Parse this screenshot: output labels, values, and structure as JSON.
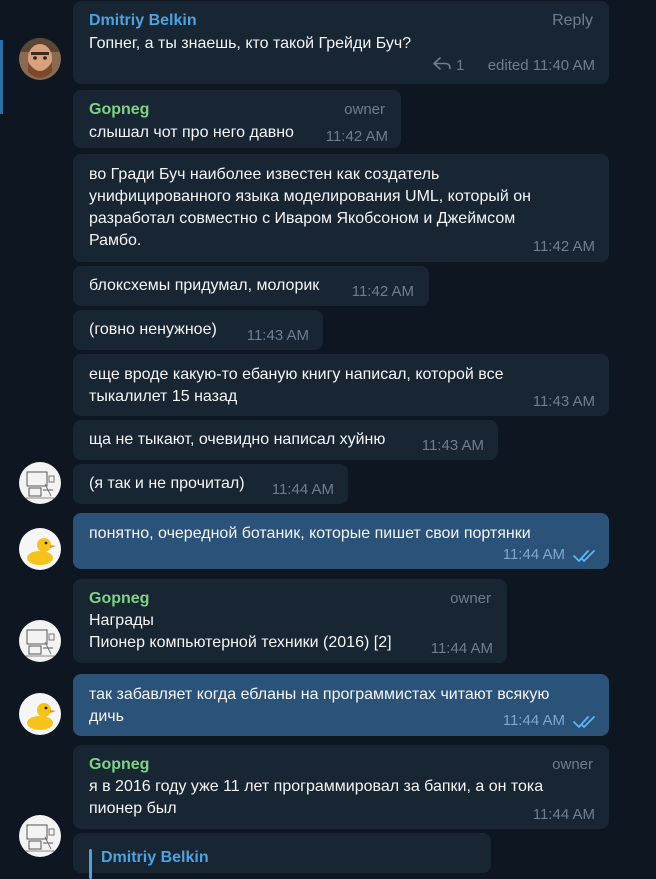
{
  "colors": {
    "background": "#0e1621",
    "bubble_in": "#182533",
    "bubble_out": "#2b5278",
    "name_gopneg": "#7fd287",
    "name_dmitriy": "#4fa2e0",
    "meta": "#6d7f8f",
    "read_check": "#5eb5f7"
  },
  "messages": [
    {
      "sender": "Dmitriy Belkin",
      "action": "Reply",
      "lines": [
        "Гопнег, а ты знаешь, кто такой Грейди Буч?"
      ],
      "reply_count": "1",
      "time": "edited 11:40 AM"
    },
    {
      "sender": "Gopneg",
      "role": "owner",
      "lines": [
        "слышал чот про него давно"
      ],
      "time": "11:42 AM"
    },
    {
      "lines": [
        "во Гради Буч наиболее известен как создатель",
        "унифицированного языка моделирования UML, который он",
        "разработал совместно с Иваром Якобсоном и Джеймсом",
        "Рамбо."
      ],
      "time": "11:42 AM"
    },
    {
      "lines": [
        "блоксхемы придумал, молорик"
      ],
      "time": "11:42 AM"
    },
    {
      "lines": [
        "(говно ненужное)"
      ],
      "time": "11:43 AM"
    },
    {
      "lines": [
        "еще вроде какую-то ебаную книгу написал, которой все",
        "тыкалилет 15 назад"
      ],
      "time": "11:43 AM"
    },
    {
      "lines": [
        "ща не тыкают, очевидно написал хуйню"
      ],
      "time": "11:43 AM"
    },
    {
      "lines": [
        "(я так и не прочитал)"
      ],
      "time": "11:44 AM"
    },
    {
      "lines": [
        "понятно, очередной ботаник, которые пишет свои портянки"
      ],
      "time": "11:44 AM"
    },
    {
      "sender": "Gopneg",
      "role": "owner",
      "lines": [
        "Награды",
        "Пионер компьютерной техники (2016) [2]"
      ],
      "time": "11:44 AM"
    },
    {
      "lines": [
        "так забавляет когда ебланы на программистах читают всякую",
        "дичь"
      ],
      "time": "11:44 AM"
    },
    {
      "sender": "Gopneg",
      "role": "owner",
      "lines": [
        "я в 2016 году уже 11 лет программировал за бапки, а он тока",
        "пионер был"
      ],
      "time": "11:44 AM"
    },
    {
      "quote_name": "Dmitriy Belkin"
    }
  ],
  "avatars": {
    "dmitriy": "bearded-man-avatar",
    "gopneg": "sketch-drawing-avatar",
    "self": "rubber-duck-avatar"
  }
}
